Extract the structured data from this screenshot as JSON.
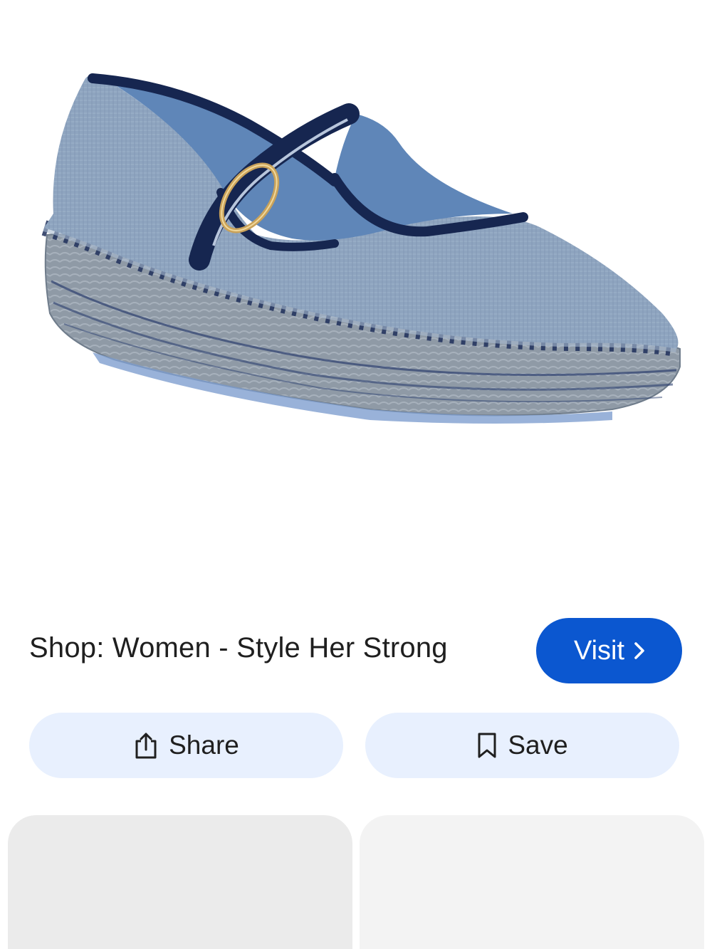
{
  "result": {
    "image_subject": "blue-espadrille-mary-jane-shoe",
    "source_title": "Shop: Women - Style Her Strong",
    "visit_label": "Visit",
    "visit_icon": "chevron-right-icon"
  },
  "actions": {
    "share_label": "Share",
    "share_icon": "share-icon",
    "save_label": "Save",
    "save_icon": "bookmark-icon"
  },
  "colors": {
    "accent": "#0b57d0",
    "pill_bg": "#e8f0fe",
    "text": "#1f1f1f"
  }
}
